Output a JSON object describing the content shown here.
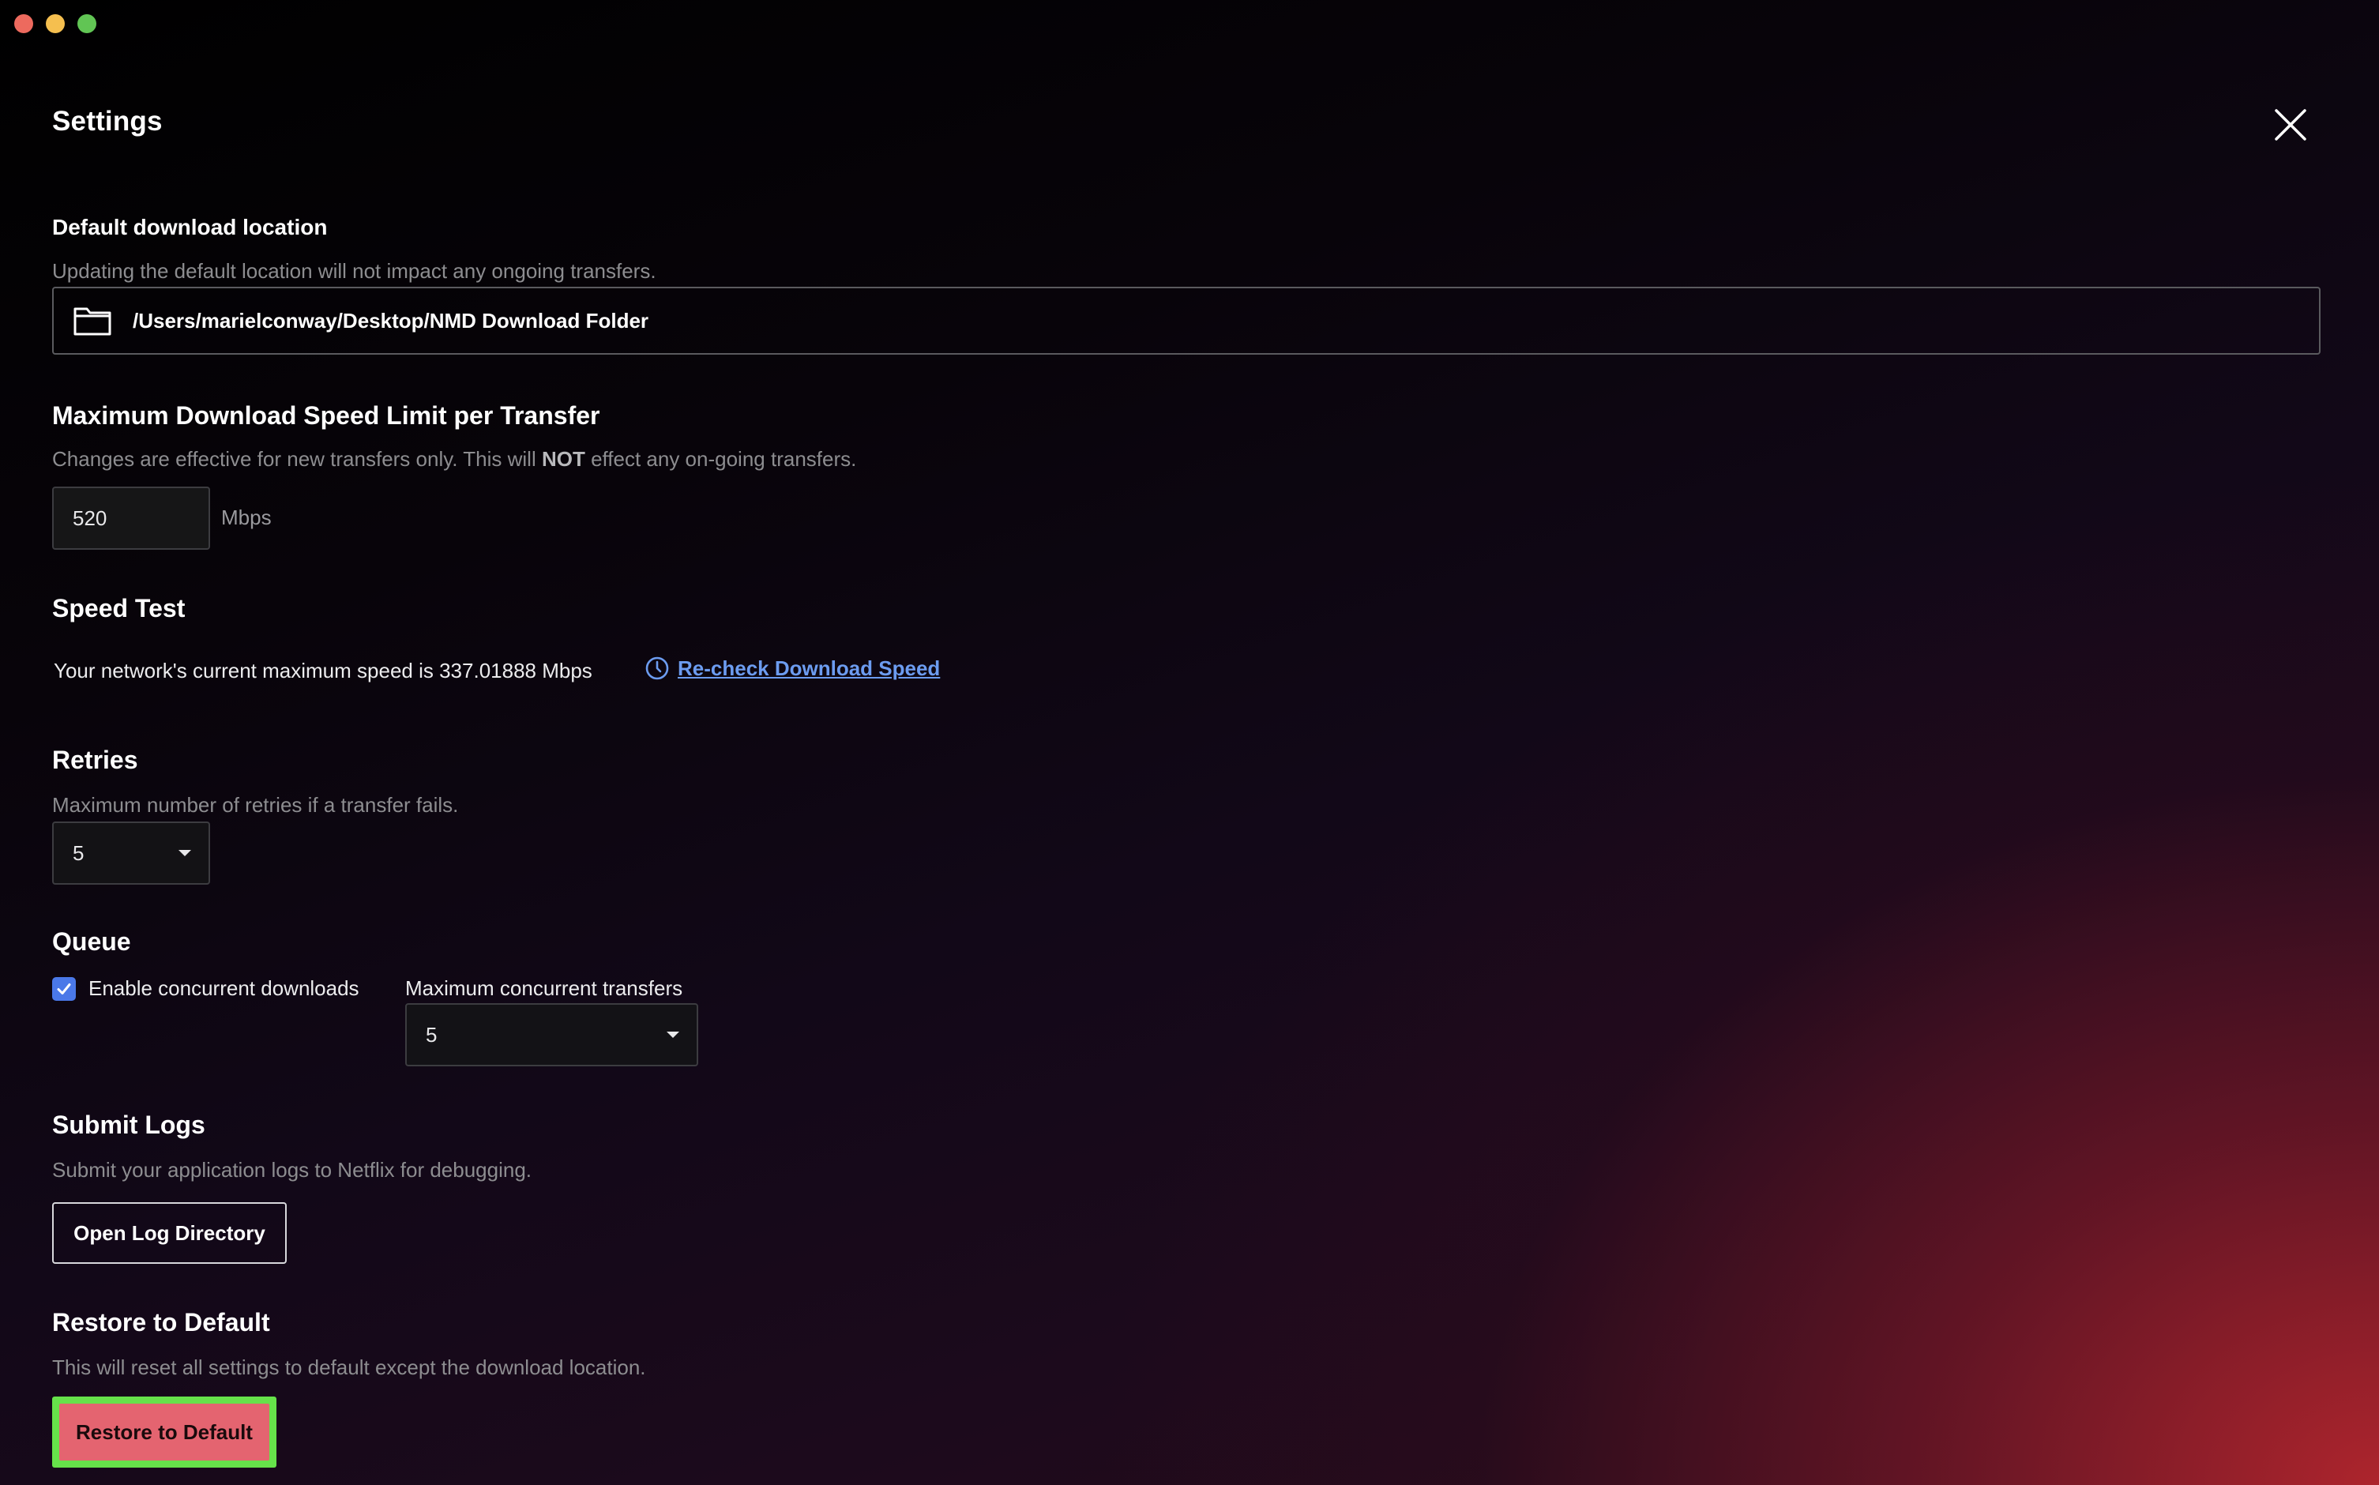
{
  "window": {
    "controls": [
      "close",
      "minimize",
      "zoom"
    ]
  },
  "header": {
    "title": "Settings",
    "close_icon": "close-icon"
  },
  "download_location": {
    "title": "Default download location",
    "description": "Updating the default location will not impact any ongoing transfers.",
    "icon": "folder-icon",
    "path": "/Users/marielconway/Desktop/NMD Download Folder"
  },
  "speed_limit": {
    "title": "Maximum Download Speed Limit per Transfer",
    "description_before": "Changes are effective for new transfers only. This will ",
    "description_bold": "NOT",
    "description_after": " effect any on-going transfers.",
    "value": "520",
    "unit": "Mbps"
  },
  "speed_test": {
    "title": "Speed Test",
    "result_text": "Your network's current maximum speed is 337.01888 Mbps",
    "icon": "clock-icon",
    "link_label": "Re-check Download Speed",
    "link_color": "#6c9cf0"
  },
  "retries": {
    "title": "Retries",
    "description": "Maximum number of retries if a transfer fails.",
    "selected": "5"
  },
  "queue": {
    "title": "Queue",
    "checkbox_label": "Enable concurrent downloads",
    "checkbox_checked": true,
    "checkbox_color": "#4a78e8",
    "concurrent_label": "Maximum concurrent transfers",
    "concurrent_selected": "5"
  },
  "logs": {
    "title": "Submit Logs",
    "description": "Submit your application logs to Netflix for debugging.",
    "button_label": "Open Log Directory"
  },
  "restore": {
    "title": "Restore to Default",
    "description": "This will reset all settings to default except the download location.",
    "button_label": "Restore to Default",
    "button_color": "#e46470",
    "highlight_color": "#66e24a"
  }
}
